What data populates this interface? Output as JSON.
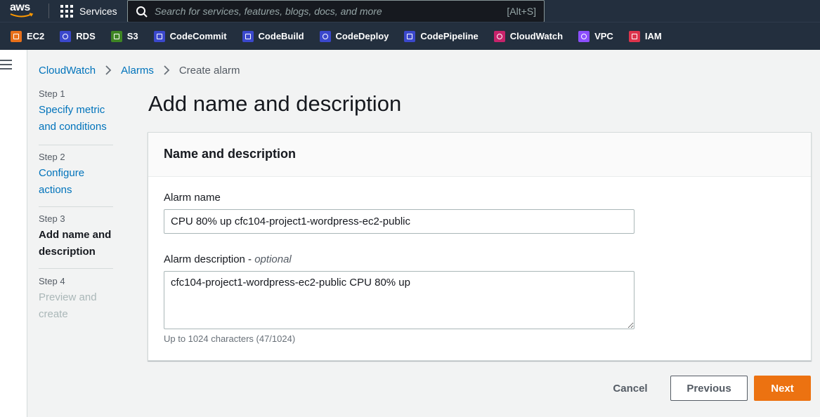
{
  "topnav": {
    "logo_text": "aws",
    "services_label": "Services",
    "search_placeholder": "Search for services, features, blogs, docs, and more",
    "search_shortcut": "[Alt+S]"
  },
  "favorites": [
    {
      "label": "EC2",
      "icon": "ec2-icon",
      "color": "#e8701a"
    },
    {
      "label": "RDS",
      "icon": "rds-icon",
      "color": "#3b48cc"
    },
    {
      "label": "S3",
      "icon": "s3-icon",
      "color": "#3f8624"
    },
    {
      "label": "CodeCommit",
      "icon": "codecommit-icon",
      "color": "#3b48cc"
    },
    {
      "label": "CodeBuild",
      "icon": "codebuild-icon",
      "color": "#3b48cc"
    },
    {
      "label": "CodeDeploy",
      "icon": "codedeploy-icon",
      "color": "#3b48cc"
    },
    {
      "label": "CodePipeline",
      "icon": "codepipeline-icon",
      "color": "#3b48cc"
    },
    {
      "label": "CloudWatch",
      "icon": "cloudwatch-icon",
      "color": "#c7236b"
    },
    {
      "label": "VPC",
      "icon": "vpc-icon",
      "color": "#8c4fff"
    },
    {
      "label": "IAM",
      "icon": "iam-icon",
      "color": "#dd344c"
    }
  ],
  "breadcrumb": {
    "items": [
      "CloudWatch",
      "Alarms"
    ],
    "current": "Create alarm"
  },
  "steps": [
    {
      "number": "Step 1",
      "title": "Specify metric and conditions",
      "state": "link"
    },
    {
      "number": "Step 2",
      "title": "Configure actions",
      "state": "link"
    },
    {
      "number": "Step 3",
      "title": "Add name and description",
      "state": "current"
    },
    {
      "number": "Step 4",
      "title": "Preview and create",
      "state": "disabled"
    }
  ],
  "page": {
    "title": "Add name and description"
  },
  "form": {
    "section_title": "Name and description",
    "name_label": "Alarm name",
    "name_value": "CPU 80% up cfc104-project1-wordpress-ec2-public",
    "desc_label": "Alarm description - ",
    "desc_optional": "optional",
    "desc_value": "cfc104-project1-wordpress-ec2-public CPU 80% up",
    "constraint": "Up to 1024 characters (47/1024)"
  },
  "actions": {
    "cancel": "Cancel",
    "previous": "Previous",
    "next": "Next"
  },
  "colors": {
    "nav_bg": "#232f3e",
    "link": "#0073bb",
    "primary": "#ec7211"
  }
}
